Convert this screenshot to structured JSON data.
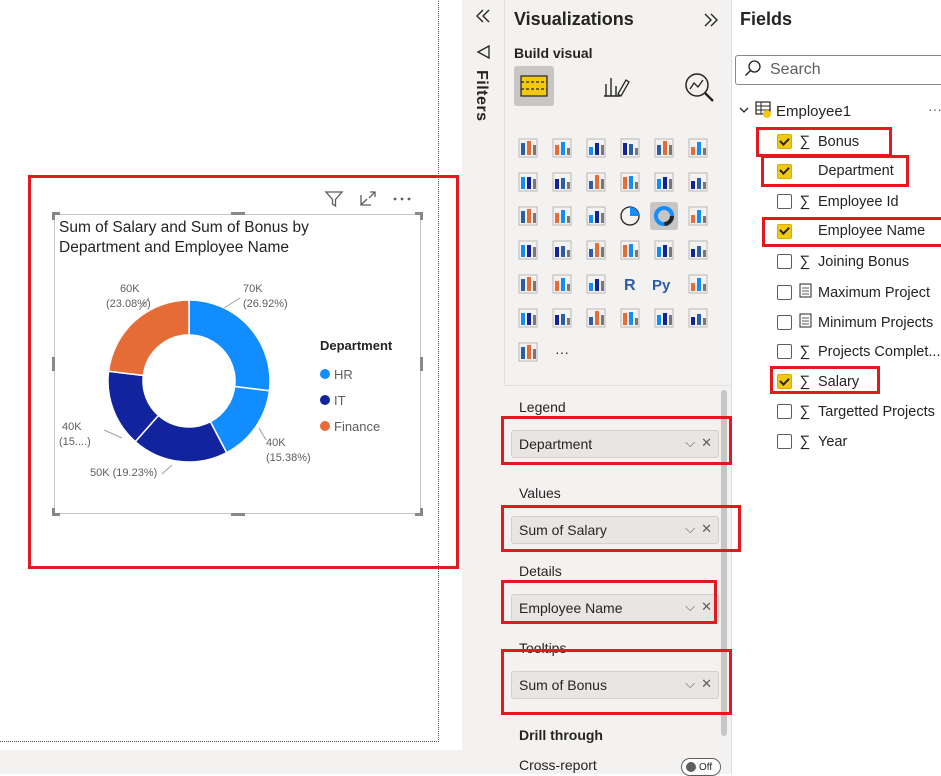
{
  "visual": {
    "title": "Sum of Salary and Sum of Bonus by Department and Employee Name",
    "legend_title": "Department",
    "legend": [
      {
        "label": "HR",
        "color": "#118dff"
      },
      {
        "label": "IT",
        "color": "#12239e"
      },
      {
        "label": "Finance",
        "color": "#e66c37"
      }
    ],
    "header_icons": [
      "filter-icon",
      "focus-mode-icon",
      "more-options-icon"
    ]
  },
  "chart_data": {
    "type": "pie",
    "title": "Sum of Salary and Sum of Bonus by Department and Employee Name",
    "slices": [
      {
        "department": "HR",
        "value": 70000,
        "label": "70K",
        "pct": "(26.92%)",
        "color": "#118dff"
      },
      {
        "department": "HR",
        "value": 40000,
        "label": "40K",
        "pct": "(15.38%)",
        "color": "#118dff"
      },
      {
        "department": "IT",
        "value": 50000,
        "label": "50K (19.23%)",
        "pct": "",
        "color": "#12239e"
      },
      {
        "department": "IT",
        "value": 40000,
        "label": "40K",
        "pct": "(15....)",
        "color": "#12239e"
      },
      {
        "department": "Finance",
        "value": 60000,
        "label": "60K",
        "pct": "(23.08%)",
        "color": "#e66c37"
      }
    ],
    "donut": true,
    "legend_position": "right"
  },
  "filters": {
    "label": "Filters"
  },
  "viz_pane": {
    "title": "Visualizations",
    "build_visual": "Build visual",
    "more_visuals": "···",
    "wells": [
      {
        "label": "Legend",
        "field": "Department"
      },
      {
        "label": "Values",
        "field": "Sum of Salary"
      },
      {
        "label": "Details",
        "field": "Employee Name"
      },
      {
        "label": "Tooltips",
        "field": "Sum of Bonus"
      }
    ],
    "drill_through": "Drill through",
    "cross_report": "Cross-report",
    "toggle_state": "Off"
  },
  "fields_pane": {
    "title": "Fields",
    "search_placeholder": "Search",
    "table": "Employee1",
    "more": "···",
    "fields": [
      {
        "name": "Bonus",
        "checked": true,
        "sigma": true
      },
      {
        "name": "Department",
        "checked": true,
        "sigma": false
      },
      {
        "name": "Employee Id",
        "checked": false,
        "sigma": true
      },
      {
        "name": "Employee Name",
        "checked": true,
        "sigma": false
      },
      {
        "name": "Joining Bonus",
        "checked": false,
        "sigma": true
      },
      {
        "name": "Maximum Project",
        "checked": false,
        "sigma": false
      },
      {
        "name": "Minimum Projects",
        "checked": false,
        "sigma": false
      },
      {
        "name": "Projects Complet...",
        "checked": false,
        "sigma": true
      },
      {
        "name": "Salary",
        "checked": true,
        "sigma": true
      },
      {
        "name": "Targetted Projects",
        "checked": false,
        "sigma": true
      },
      {
        "name": "Year",
        "checked": false,
        "sigma": true
      }
    ]
  }
}
